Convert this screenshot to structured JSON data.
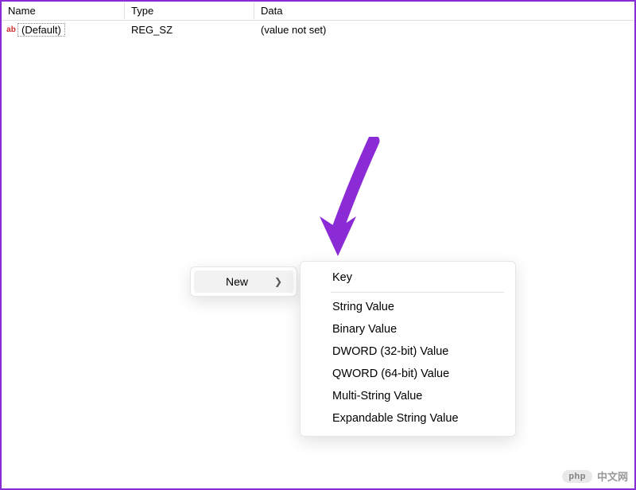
{
  "columns": {
    "name": "Name",
    "type": "Type",
    "data": "Data"
  },
  "rows": [
    {
      "name": "(Default)",
      "type": "REG_SZ",
      "data": "(value not set)"
    }
  ],
  "contextMenu": {
    "new_label": "New",
    "submenu": {
      "key": "Key",
      "string": "String Value",
      "binary": "Binary Value",
      "dword": "DWORD (32-bit) Value",
      "qword": "QWORD (64-bit) Value",
      "multistring": "Multi-String Value",
      "expandable": "Expandable String Value"
    }
  },
  "watermark": {
    "badge": "php",
    "text": "中文网"
  },
  "colors": {
    "accent": "#8b2bd6"
  }
}
